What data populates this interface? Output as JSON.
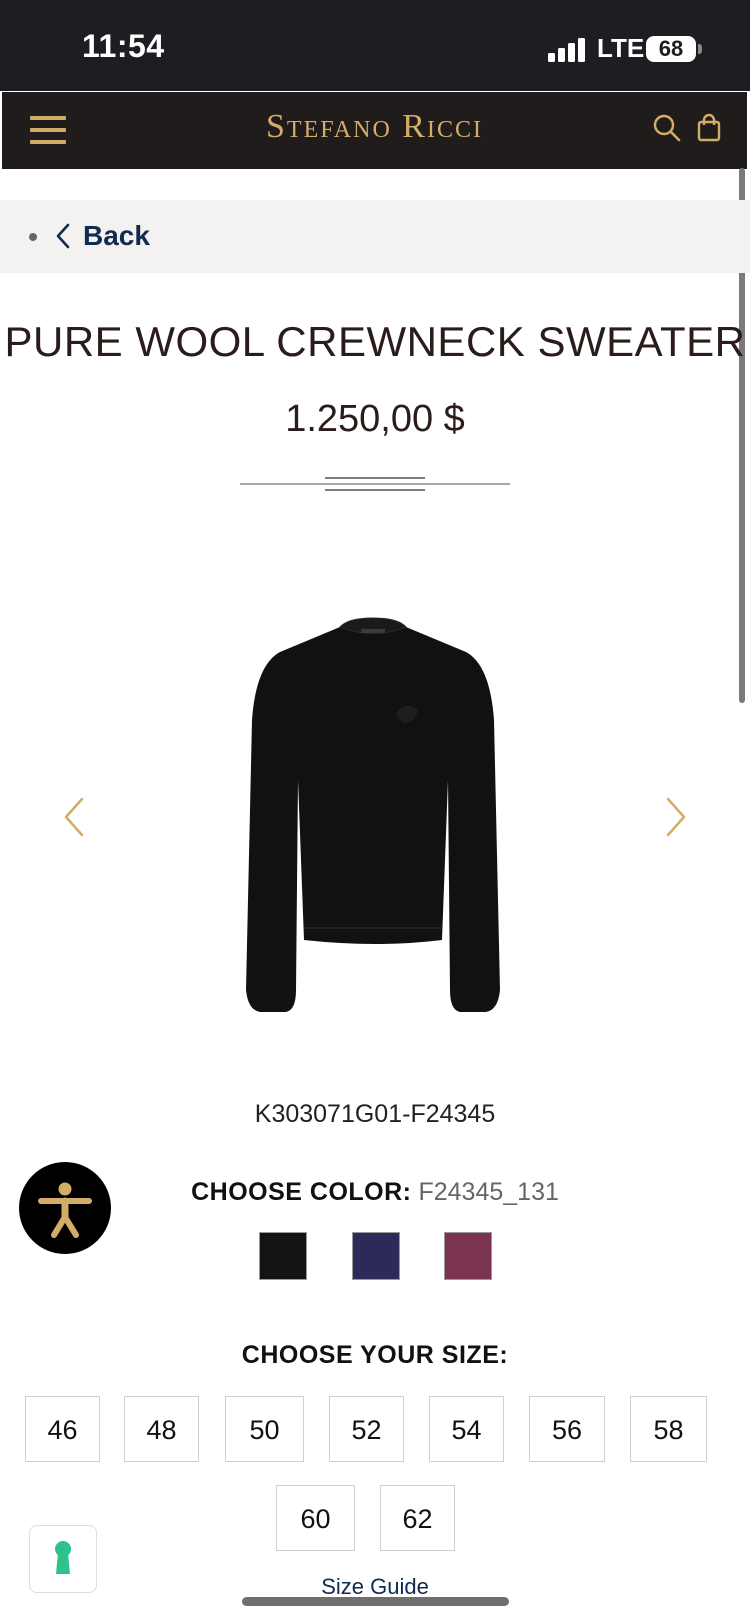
{
  "status_bar": {
    "time": "11:54",
    "network": "LTE",
    "battery": "68"
  },
  "header": {
    "brand": "Stefano Ricci",
    "menu_icon": "hamburger-menu-icon",
    "search_icon": "search-icon",
    "cart_icon": "shopping-bag-icon",
    "accent_color": "#d3ad68",
    "background": "#201c1c"
  },
  "nav": {
    "back_label": "Back"
  },
  "product": {
    "title": "PURE WOOL CREWNECK SWEATER",
    "price": "1.250,00 $",
    "sku": "K303071G01-F24345",
    "image_alt": "black crewneck sweater"
  },
  "color": {
    "label": "CHOOSE COLOR:",
    "selected": "F24345_131",
    "swatches": [
      {
        "name": "black",
        "hex": "#131313"
      },
      {
        "name": "navy",
        "hex": "#2c2a58"
      },
      {
        "name": "burgundy",
        "hex": "#7a3452"
      }
    ]
  },
  "size": {
    "label": "CHOOSE YOUR SIZE:",
    "options": [
      "46",
      "48",
      "50",
      "52",
      "54",
      "56",
      "58",
      "60",
      "62"
    ],
    "guide_label": "Size Guide"
  }
}
